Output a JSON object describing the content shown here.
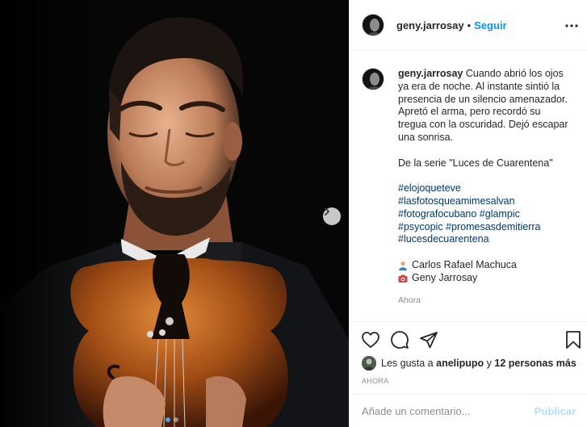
{
  "post": {
    "author": "geny.jarrosay",
    "separator": "•",
    "follow_label": "Seguir",
    "more_icon": "more-horizontal-icon"
  },
  "caption": {
    "username": "geny.jarrosay",
    "text": "Cuando abrió los ojos ya era de noche. Al instante sintió la presencia de un silencio amenazador. Apretó el arma, pero recordó su tregua con la oscuridad. Dejó escapar una sonrisa.",
    "series_line": "De la serie \"Luces de Cuarentena\"",
    "hashtags": {
      "h1": "#elojoqueteve",
      "h2": "#lasfotosqueamimesalvan",
      "h3": "#fotografocubano",
      "h4": "#glampic",
      "h5": "#psycopic",
      "h6": "#promesasdemitierra",
      "h7": "#lucesdecuarentena"
    },
    "credits": [
      {
        "icon": "person-emoji",
        "text": "Carlos Rafael Machuca"
      },
      {
        "icon": "camera-emoji",
        "text": "Geny Jarrosay"
      }
    ],
    "time": "Ahora"
  },
  "likes": {
    "prefix": "Les gusta a",
    "user": "anelipupo",
    "joiner": "y",
    "others": "12 personas más"
  },
  "posted_time": "AHORA",
  "comment_box": {
    "placeholder": "Añade un comentario...",
    "publish_label": "Publicar"
  },
  "colors": {
    "link_blue": "#0095f6",
    "hashtag": "#00376b",
    "muted": "#8e8e8e",
    "publish_disabled": "#b2dffc"
  },
  "carousel": {
    "count": 2,
    "active": 1
  }
}
